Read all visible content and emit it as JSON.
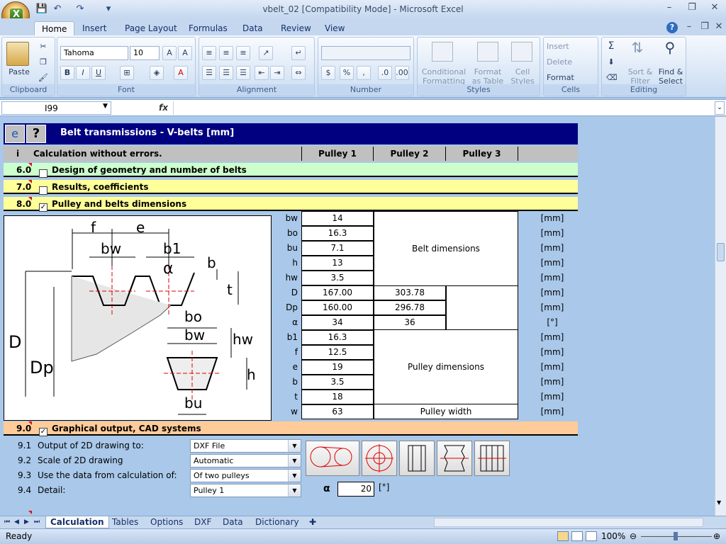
{
  "window": {
    "title": "vbelt_02  [Compatibility Mode] - Microsoft Excel"
  },
  "ribbon_tabs": [
    "Home",
    "Insert",
    "Page Layout",
    "Formulas",
    "Data",
    "Review",
    "View"
  ],
  "ribbon": {
    "clipboard": {
      "label": "Clipboard",
      "paste": "Paste"
    },
    "font": {
      "label": "Font",
      "name": "Tahoma",
      "size": "10"
    },
    "alignment": {
      "label": "Alignment"
    },
    "number": {
      "label": "Number",
      "format": ""
    },
    "styles": {
      "label": "Styles",
      "conditional": "Conditional Formatting",
      "format_table": "Format as Table",
      "cell_styles": "Cell Styles"
    },
    "cells": {
      "label": "Cells",
      "insert": "Insert",
      "delete": "Delete",
      "format": "Format"
    },
    "editing": {
      "label": "Editing",
      "sort": "Sort & Filter",
      "find": "Find & Select"
    }
  },
  "formula_bar": {
    "name_box": "I99",
    "fx": "fx",
    "value": ""
  },
  "sheet": {
    "header_title": "Belt transmissions - V-belts [mm]",
    "status_row": {
      "marker": "i",
      "text": "Calculation without errors.",
      "col1": "Pulley 1",
      "col2": "Pulley 2",
      "col3": "Pulley 3"
    },
    "sections": [
      {
        "num": "6.0",
        "title": "Design of geometry and number of belts",
        "checked": ""
      },
      {
        "num": "7.0",
        "title": "Results, coefficients",
        "checked": ""
      },
      {
        "num": "8.0",
        "title": "Pulley and belts dimensions",
        "checked": "✓"
      },
      {
        "num": "9.0",
        "title": "Graphical output, CAD systems",
        "checked": "✓"
      }
    ],
    "diagram_labels": {
      "f": "f",
      "e": "e",
      "bw": "bw",
      "b1": "b1",
      "alpha": "α",
      "b": "b",
      "t": "t",
      "D": "D",
      "Dp": "Dp",
      "bo": "bo",
      "bw2": "bw",
      "hw": "hw",
      "h": "h",
      "bu": "bu"
    },
    "dimensions": [
      {
        "label": "bw",
        "v1": "14",
        "unit": "[mm]"
      },
      {
        "label": "bo",
        "v1": "16.3",
        "unit": "[mm]"
      },
      {
        "label": "bu",
        "v1": "7.1",
        "unit": "[mm]"
      },
      {
        "label": "h",
        "v1": "13",
        "unit": "[mm]"
      },
      {
        "label": "hw",
        "v1": "3.5",
        "unit": "[mm]"
      },
      {
        "label": "D",
        "v1": "167.00",
        "v2": "303.78",
        "unit": "[mm]"
      },
      {
        "label": "Dp",
        "v1": "160.00",
        "v2": "296.78",
        "unit": "[mm]"
      },
      {
        "label": "α",
        "v1": "34",
        "v2": "36",
        "unit": "[°]"
      },
      {
        "label": "b1",
        "v1": "16.3",
        "unit": "[mm]"
      },
      {
        "label": "f",
        "v1": "12.5",
        "unit": "[mm]"
      },
      {
        "label": "e",
        "v1": "19",
        "unit": "[mm]"
      },
      {
        "label": "b",
        "v1": "3.5",
        "unit": "[mm]"
      },
      {
        "label": "t",
        "v1": "18",
        "unit": "[mm]"
      },
      {
        "label": "w",
        "v1": "63",
        "unit": "[mm]"
      }
    ],
    "belt_dimensions_label": "Belt dimensions",
    "pulley_dimensions_label": "Pulley dimensions",
    "pulley_width_label": "Pulley width",
    "graphical": [
      {
        "num": "9.1",
        "label": "Output of 2D drawing to:",
        "value": "DXF File"
      },
      {
        "num": "9.2",
        "label": "Scale of 2D drawing",
        "value": "Automatic"
      },
      {
        "num": "9.3",
        "label": "Use the data from calculation of:",
        "value": "Of two pulleys"
      },
      {
        "num": "9.4",
        "label": "Detail:",
        "value": "Pulley 1"
      }
    ],
    "alpha_input": {
      "label": "α",
      "value": "20",
      "unit": "[°]"
    }
  },
  "sheet_tabs": [
    "Calculation",
    "Tables",
    "Options",
    "DXF",
    "Data",
    "Dictionary"
  ],
  "status": {
    "ready": "Ready",
    "zoom": "100%"
  }
}
